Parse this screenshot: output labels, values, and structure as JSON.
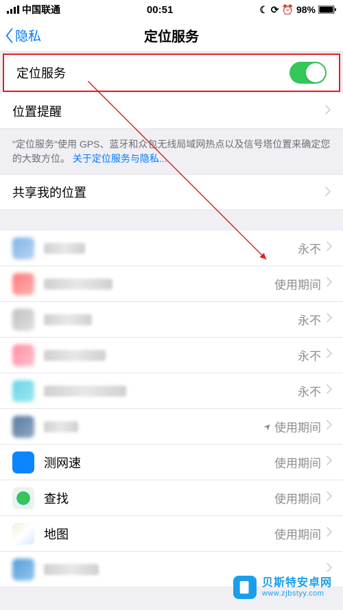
{
  "status_bar": {
    "carrier": "中国联通",
    "time": "00:51",
    "battery_pct": "98%"
  },
  "nav": {
    "back_label": "隐私",
    "title": "定位服务"
  },
  "rows": {
    "location_services_label": "定位服务",
    "location_alerts_label": "位置提醒",
    "share_location_label": "共享我的位置"
  },
  "description": {
    "text": "\"定位服务\"使用 GPS、蓝牙和众包无线局域网热点以及信号塔位置来确定您的大致方位。",
    "link_text": "关于定位服务与隐私..."
  },
  "status_values": {
    "never": "永不",
    "while_using": "使用期间"
  },
  "apps": [
    {
      "name": "",
      "status": "never",
      "blur": true,
      "icon_bg": "linear-gradient(135deg,#7fb3e8,#b8d4f0)",
      "name_w": 60
    },
    {
      "name": "",
      "status": "while_using",
      "blur": true,
      "icon_bg": "linear-gradient(135deg,#ff7b7b,#ffb0b0)",
      "name_w": 100
    },
    {
      "name": "",
      "status": "never",
      "blur": true,
      "icon_bg": "linear-gradient(135deg,#c0c0c0,#e0e0e0)",
      "name_w": 70
    },
    {
      "name": "",
      "status": "never",
      "blur": true,
      "icon_bg": "linear-gradient(135deg,#ff8fa4,#ffc0ce)",
      "name_w": 90
    },
    {
      "name": "",
      "status": "never",
      "blur": true,
      "icon_bg": "linear-gradient(135deg,#6ad4e8,#a0e8f0)",
      "name_w": 120
    },
    {
      "name": "",
      "status": "while_using",
      "blur": true,
      "icon_bg": "linear-gradient(135deg,#5a7aa0,#8fa8c4)",
      "name_w": 50,
      "arrow": true
    },
    {
      "name": "测网速",
      "status": "while_using",
      "blur": false,
      "icon_bg": "#0a84ff"
    },
    {
      "name": "查找",
      "status": "while_using",
      "blur": false,
      "icon_bg": "radial-gradient(circle,#34c759 40%,#0a84ff 42%,#e8f5ea 44%)"
    },
    {
      "name": "地图",
      "status": "while_using",
      "blur": false,
      "icon_bg": "linear-gradient(135deg,#e8f5d8 0%,#fff 50%,#d8e8ff 100%)"
    },
    {
      "name": "",
      "status": "",
      "blur": true,
      "icon_bg": "linear-gradient(135deg,#5aa0d8,#8fc4f0)",
      "name_w": 80
    }
  ],
  "watermark": {
    "name": "贝斯特安卓网",
    "domain": "www.zjbstyy.com"
  }
}
